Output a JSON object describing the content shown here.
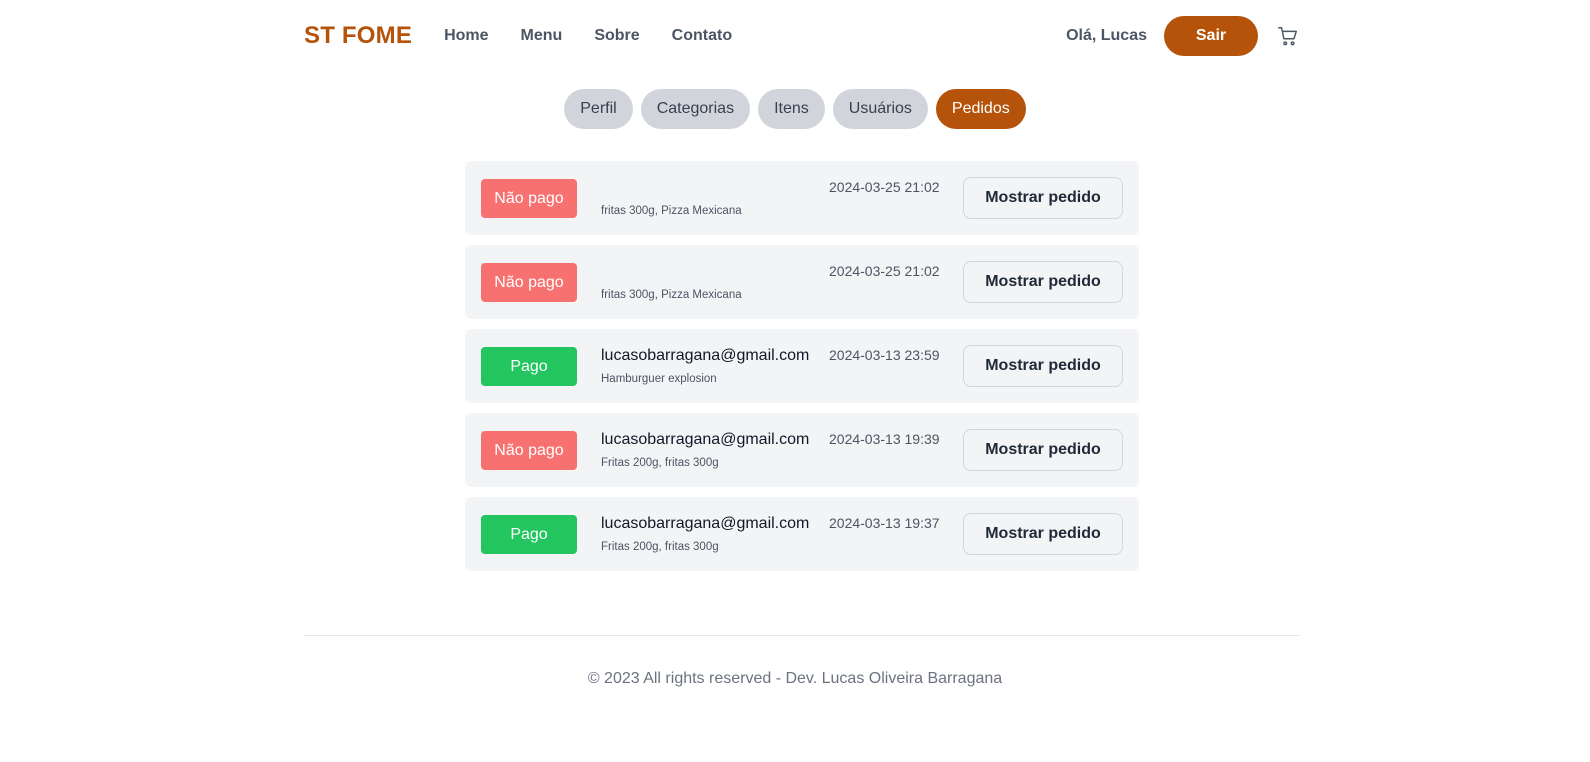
{
  "header": {
    "logo": "ST FOME",
    "nav": [
      "Home",
      "Menu",
      "Sobre",
      "Contato"
    ],
    "greeting": "Olá, Lucas",
    "logout_label": "Sair",
    "cart_icon": "cart-icon"
  },
  "tabs": [
    {
      "label": "Perfil",
      "active": false
    },
    {
      "label": "Categorias",
      "active": false
    },
    {
      "label": "Itens",
      "active": false
    },
    {
      "label": "Usuários",
      "active": false
    },
    {
      "label": "Pedidos",
      "active": true
    }
  ],
  "orders": [
    {
      "status": "Não pago",
      "paid": false,
      "email": "",
      "items": "fritas 300g, Pizza Mexicana",
      "date": "2024-03-25 21:02",
      "button": "Mostrar pedido"
    },
    {
      "status": "Não pago",
      "paid": false,
      "email": "",
      "items": "fritas 300g, Pizza Mexicana",
      "date": "2024-03-25 21:02",
      "button": "Mostrar pedido"
    },
    {
      "status": "Pago",
      "paid": true,
      "email": "lucasobarragana@gmail.com",
      "items": "Hamburguer explosion",
      "date": "2024-03-13 23:59",
      "button": "Mostrar pedido"
    },
    {
      "status": "Não pago",
      "paid": false,
      "email": "lucasobarragana@gmail.com",
      "items": "Fritas 200g, fritas 300g",
      "date": "2024-03-13 19:39",
      "button": "Mostrar pedido"
    },
    {
      "status": "Pago",
      "paid": true,
      "email": "lucasobarragana@gmail.com",
      "items": "Fritas 200g, fritas 300g",
      "date": "2024-03-13 19:37",
      "button": "Mostrar pedido"
    }
  ],
  "footer": {
    "text": "© 2023 All rights reserved - Dev. Lucas Oliveira Barragana"
  },
  "colors": {
    "brand": "#b45309",
    "unpaid": "#f87171",
    "paid": "#22c55e"
  }
}
